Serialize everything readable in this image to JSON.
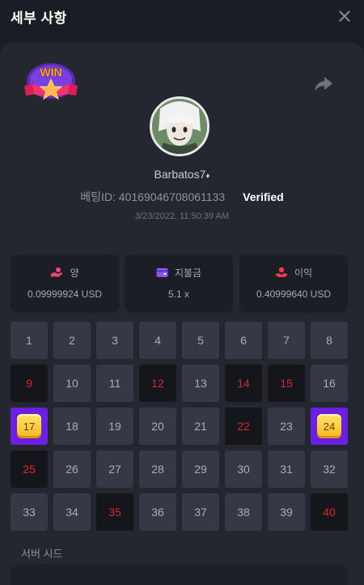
{
  "modal": {
    "title": "세부 사항"
  },
  "player": {
    "username": "Barbatos7",
    "username_mark": "♦"
  },
  "bet": {
    "bet_id": "베팅ID: 40169046708061133",
    "verified": "Verified",
    "timestamp": "3/23/2022, 11:50:39 AM"
  },
  "badge": {
    "text": "WIN"
  },
  "stats": [
    {
      "label": "양",
      "value": "0.09999924 USD",
      "icon": "coin-hand-icon"
    },
    {
      "label": "지불금",
      "value": "5.1 x",
      "icon": "wallet-icon"
    },
    {
      "label": "이익",
      "value": "0.40999640 USD",
      "icon": "profit-hand-icon"
    }
  ],
  "grid": {
    "numbers": [
      1,
      2,
      3,
      4,
      5,
      6,
      7,
      8,
      9,
      10,
      11,
      12,
      13,
      14,
      15,
      16,
      17,
      18,
      19,
      20,
      21,
      22,
      23,
      24,
      25,
      26,
      27,
      28,
      29,
      30,
      31,
      32,
      33,
      34,
      35,
      36,
      37,
      38,
      39,
      40
    ],
    "picked_red": [
      9,
      12,
      14,
      15,
      22,
      25,
      35,
      40
    ],
    "hits": [
      17,
      24
    ]
  },
  "colors": {
    "background": "#1a1d24",
    "panel": "#24272f",
    "cell": "#353945",
    "cell_picked": "#14161b",
    "picked_text": "#d42a2a",
    "hit": "#6d1fe0",
    "gem": "#f5c52a",
    "icon_pink": "#f0467a",
    "icon_purple": "#8b56f0",
    "icon_red": "#ef3b4d"
  },
  "server_seed": {
    "label": "서버 시드"
  }
}
